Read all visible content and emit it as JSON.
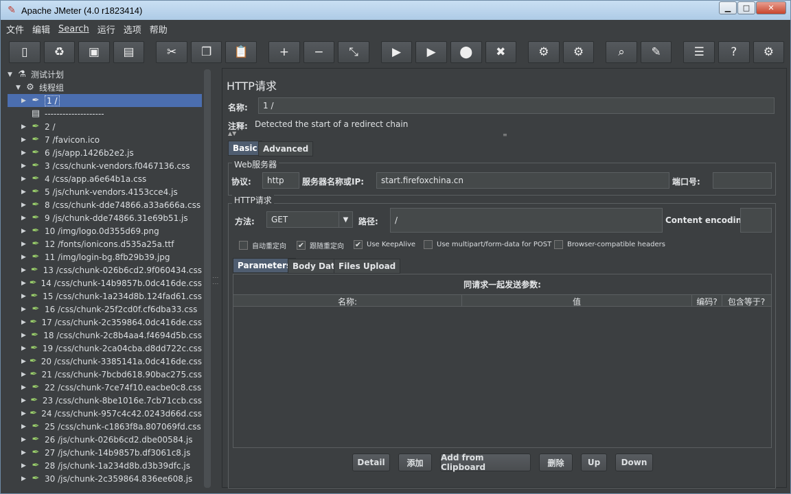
{
  "window": {
    "title": "Apache JMeter (4.0 r1823414)",
    "min": "▁",
    "max": "□",
    "close": "✕"
  },
  "menu": [
    "文件",
    "编辑",
    "Search",
    "运行",
    "选项",
    "帮助"
  ],
  "toolbar": [
    {
      "name": "new-icon",
      "glyph": "▯"
    },
    {
      "name": "templates-icon",
      "glyph": "♻"
    },
    {
      "name": "open-icon",
      "glyph": "▣"
    },
    {
      "name": "save-icon",
      "glyph": "▤"
    },
    {
      "name": "cut-icon",
      "glyph": "✂",
      "gap": true
    },
    {
      "name": "copy-icon",
      "glyph": "❐"
    },
    {
      "name": "paste-icon",
      "glyph": "📋"
    },
    {
      "name": "expand-icon",
      "glyph": "+",
      "gap": true
    },
    {
      "name": "collapse-icon",
      "glyph": "−"
    },
    {
      "name": "toggle-icon",
      "glyph": "⤡"
    },
    {
      "name": "start-icon",
      "glyph": "▶",
      "gap": true
    },
    {
      "name": "start-no-pause-icon",
      "glyph": "▶"
    },
    {
      "name": "stop-icon",
      "glyph": "⬤"
    },
    {
      "name": "shutdown-icon",
      "glyph": "✖"
    },
    {
      "name": "clear-icon",
      "glyph": "⚙",
      "gap": true
    },
    {
      "name": "clear-all-icon",
      "glyph": "⚙"
    },
    {
      "name": "search-icon",
      "glyph": "⌕",
      "gap": true
    },
    {
      "name": "reset-search-icon",
      "glyph": "✎"
    },
    {
      "name": "function-helper-icon",
      "glyph": "☰",
      "gap": true
    },
    {
      "name": "help-icon",
      "glyph": "?"
    },
    {
      "name": "remote-icon",
      "glyph": "⚙"
    }
  ],
  "tree": {
    "root": "测试计划",
    "thread_group": "线程组",
    "selected": "1 /",
    "separator": "--------------------",
    "items": [
      "2 /",
      "7 /favicon.ico",
      "6 /js/app.1426b2e2.js",
      "3 /css/chunk-vendors.f0467136.css",
      "4 /css/app.a6e64b1a.css",
      "5 /js/chunk-vendors.4153cce4.js",
      "8 /css/chunk-dde74866.a33a666a.css",
      "9 /js/chunk-dde74866.31e69b51.js",
      "10 /img/logo.0d355d69.png",
      "12 /fonts/ionicons.d535a25a.ttf",
      "11 /img/login-bg.8fb29b39.jpg",
      "13 /css/chunk-026b6cd2.9f060434.css",
      "14 /css/chunk-14b9857b.0dc416de.css",
      "15 /css/chunk-1a234d8b.124fad61.css",
      "16 /css/chunk-25f2cd0f.cf6dba33.css",
      "17 /css/chunk-2c359864.0dc416de.css",
      "18 /css/chunk-2c8b4aa4.f4694d5b.css",
      "19 /css/chunk-2ca04cba.d8dd722c.css",
      "20 /css/chunk-3385141a.0dc416de.css",
      "21 /css/chunk-7bcbd618.90bac275.css",
      "22 /css/chunk-7ce74f10.eacbe0c8.css",
      "23 /css/chunk-8be1016e.7cb71ccb.css",
      "24 /css/chunk-957c4c42.0243d66d.css",
      "25 /css/chunk-c1863f8a.807069fd.css",
      "26 /js/chunk-026b6cd2.dbe00584.js",
      "27 /js/chunk-14b9857b.df3061c8.js",
      "28 /js/chunk-1a234d8b.d3b39dfc.js",
      "30 /js/chunk-2c359864.836ee608.js"
    ]
  },
  "panel": {
    "title": "HTTP请求",
    "name_label": "名称:",
    "name_value": "1 /",
    "comment_label": "注释:",
    "comment_value": "Detected the start of a redirect chain",
    "tabs": [
      "Basic",
      "Advanced"
    ],
    "web_server": {
      "group": "Web服务器",
      "protocol_label": "协议:",
      "protocol_value": "http",
      "server_label": "服务器名称或IP:",
      "server_value": "start.firefoxchina.cn",
      "port_label": "端口号:",
      "port_value": ""
    },
    "http_request": {
      "group": "HTTP请求",
      "method_label": "方法:",
      "method_value": "GET",
      "path_label": "路径:",
      "path_value": "/",
      "encoding_label": "Content encoding:",
      "encoding_value": ""
    },
    "checkboxes": [
      {
        "label": "自动重定向",
        "checked": false
      },
      {
        "label": "跟随重定向",
        "checked": true
      },
      {
        "label": "Use KeepAlive",
        "checked": true
      },
      {
        "label": "Use multipart/form-data for POST",
        "checked": false
      },
      {
        "label": "Browser-compatible headers",
        "checked": false
      }
    ],
    "param_tabs": [
      "Parameters",
      "Body Data",
      "Files Upload"
    ],
    "params_title": "同请求一起发送参数:",
    "columns": [
      "名称:",
      "值",
      "编码?",
      "包含等于?"
    ],
    "buttons": [
      "Detail",
      "添加",
      "Add from Clipboard",
      "删除",
      "Up",
      "Down"
    ]
  }
}
